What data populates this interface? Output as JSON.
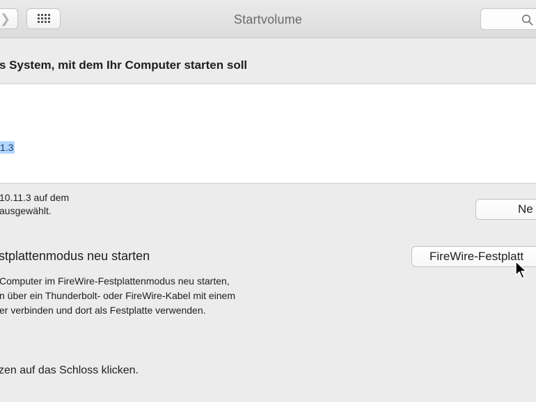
{
  "window": {
    "title": "Startvolume"
  },
  "toolbar": {
    "back_icon": "chevron-left-icon",
    "grid_icon": "grid-icon",
    "search_icon": "search-icon"
  },
  "header": {
    "title": "s System, mit dem Ihr Computer starten soll"
  },
  "volume_list": {
    "selected_label": "1.3"
  },
  "selection_info": {
    "line1": "10.11.3 auf dem",
    "line2": "ausgewählt."
  },
  "restart_button": {
    "label": "Ne"
  },
  "firewire_section": {
    "title": "stplattenmodus neu starten",
    "button_label": "FireWire-Festplatt",
    "desc_line1": "Computer im FireWire-Festplattenmodus neu starten,",
    "desc_line2": "n über ein Thunderbolt- oder FireWire-Kabel mit einem",
    "desc_line3": "er verbinden und dort als Festplatte verwenden."
  },
  "footer": {
    "lock_text": "zen auf das Schloss klicken."
  },
  "colors": {
    "selection": "#b3d7ff",
    "background": "#ececec"
  }
}
